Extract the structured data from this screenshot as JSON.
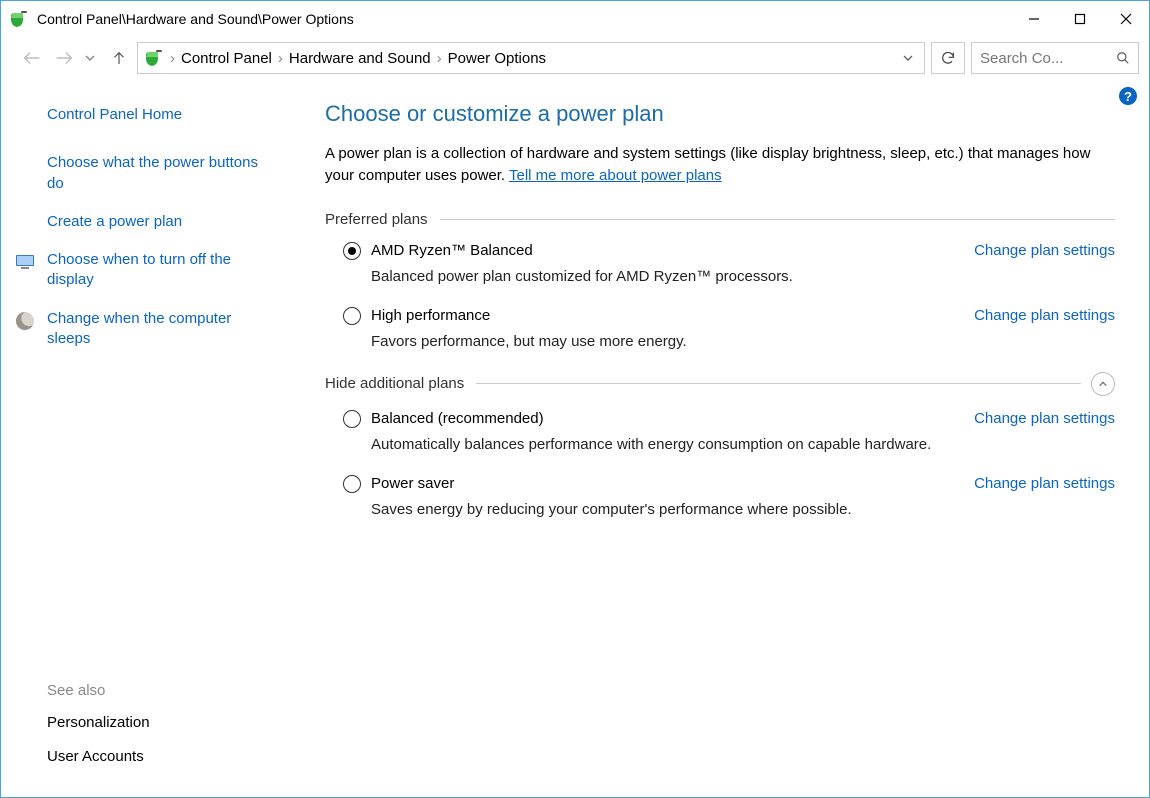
{
  "window": {
    "title": "Control Panel\\Hardware and Sound\\Power Options"
  },
  "breadcrumb": {
    "parts": [
      "Control Panel",
      "Hardware and Sound",
      "Power Options"
    ]
  },
  "search": {
    "placeholder": "Search Co..."
  },
  "sidebar": {
    "home": "Control Panel Home",
    "links": [
      "Choose what the power buttons do",
      "Create a power plan",
      "Choose when to turn off the display",
      "Change when the computer sleeps"
    ],
    "see_also_title": "See also",
    "see_also": [
      "Personalization",
      "User Accounts"
    ]
  },
  "main": {
    "title": "Choose or customize a power plan",
    "description": "A power plan is a collection of hardware and system settings (like display brightness, sleep, etc.) that manages how your computer uses power. ",
    "learn_more": "Tell me more about power plans",
    "preferred_label": "Preferred plans",
    "additional_label": "Hide additional plans",
    "change_link": "Change plan settings",
    "plans_preferred": [
      {
        "name": "AMD Ryzen™ Balanced",
        "desc": "Balanced power plan customized for AMD Ryzen™ processors.",
        "selected": true
      },
      {
        "name": "High performance",
        "desc": "Favors performance, but may use more energy.",
        "selected": false
      }
    ],
    "plans_additional": [
      {
        "name": "Balanced (recommended)",
        "desc": "Automatically balances performance with energy consumption on capable hardware.",
        "selected": false
      },
      {
        "name": "Power saver",
        "desc": "Saves energy by reducing your computer's performance where possible.",
        "selected": false
      }
    ]
  }
}
